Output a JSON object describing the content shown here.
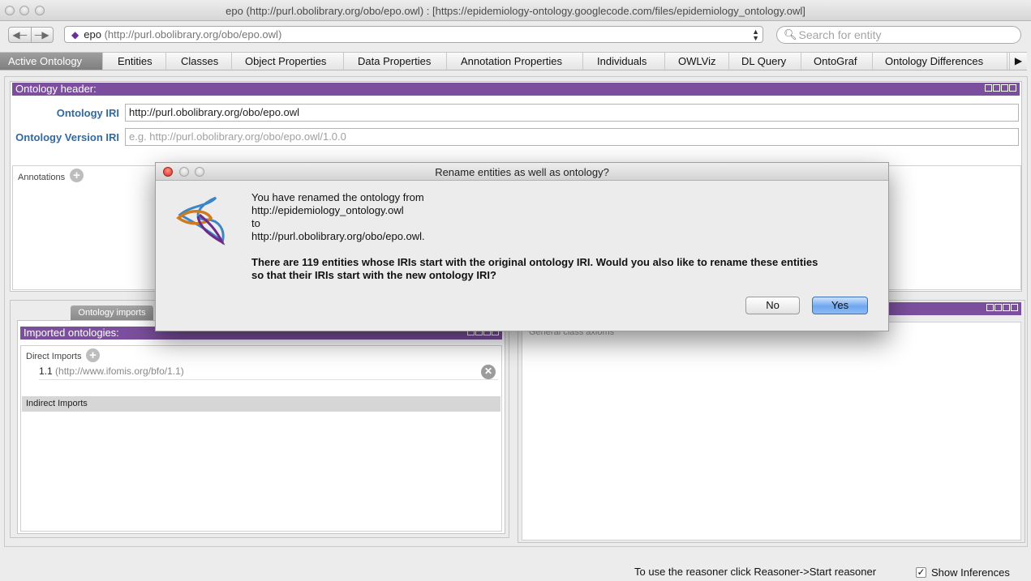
{
  "window": {
    "title": "epo (http://purl.obolibrary.org/obo/epo.owl)  : [https://epidemiology-ontology.googlecode.com/files/epidemiology_ontology.owl]"
  },
  "toolbar": {
    "back_icon": "back-arrow-icon",
    "forward_icon": "forward-arrow-icon",
    "ontology_selector": {
      "name": "epo",
      "iri": "(http://purl.obolibrary.org/obo/epo.owl)"
    },
    "search_placeholder": "Search for entity"
  },
  "tabs": [
    {
      "label": "Active Ontology",
      "active": true
    },
    {
      "label": "Entities"
    },
    {
      "label": "Classes"
    },
    {
      "label": "Object Properties"
    },
    {
      "label": "Data Properties"
    },
    {
      "label": "Annotation Properties"
    },
    {
      "label": "Individuals"
    },
    {
      "label": "OWLViz"
    },
    {
      "label": "DL Query"
    },
    {
      "label": "OntoGraf"
    },
    {
      "label": "Ontology Differences"
    }
  ],
  "ontology_header": {
    "title": "Ontology header:",
    "iri_label": "Ontology IRI",
    "iri_value": "http://purl.obolibrary.org/obo/epo.owl",
    "version_label": "Ontology Version IRI",
    "version_placeholder": "e.g. http://purl.obolibrary.org/obo/epo.owl/1.0.0",
    "annotations_label": "Annotations"
  },
  "imports": {
    "tab_label": "Ontology imports",
    "title": "Imported ontologies:",
    "direct_label": "Direct Imports",
    "direct_items": [
      {
        "name": "1.1",
        "iri": "(http://www.ifomis.org/bfo/1.1)"
      }
    ],
    "indirect_label": "Indirect Imports"
  },
  "right_panel": {
    "general_axioms_label": "General class axioms"
  },
  "status": {
    "reasoner_text": "To use the reasoner click Reasoner->Start reasoner",
    "show_inferences_label": "Show Inferences",
    "show_inferences_checked": true
  },
  "dialog": {
    "title": "Rename entities as well as ontology?",
    "line1": "You have renamed the ontology from",
    "old_iri": "http://epidemiology_ontology.owl",
    "to": "to",
    "new_iri": "http://purl.obolibrary.org/obo/epo.owl.",
    "question_line1": "There are 119 entities whose IRIs start with the original ontology IRI. Would you also like to rename these entities",
    "question_line2": "so that their IRIs start with the new ontology IRI?",
    "no_label": "No",
    "yes_label": "Yes"
  },
  "colors": {
    "purple_header": "#7b4f9d",
    "label_blue": "#2f6aa3",
    "yes_button": "#6ea6ef",
    "close_red": "#d42d22"
  }
}
